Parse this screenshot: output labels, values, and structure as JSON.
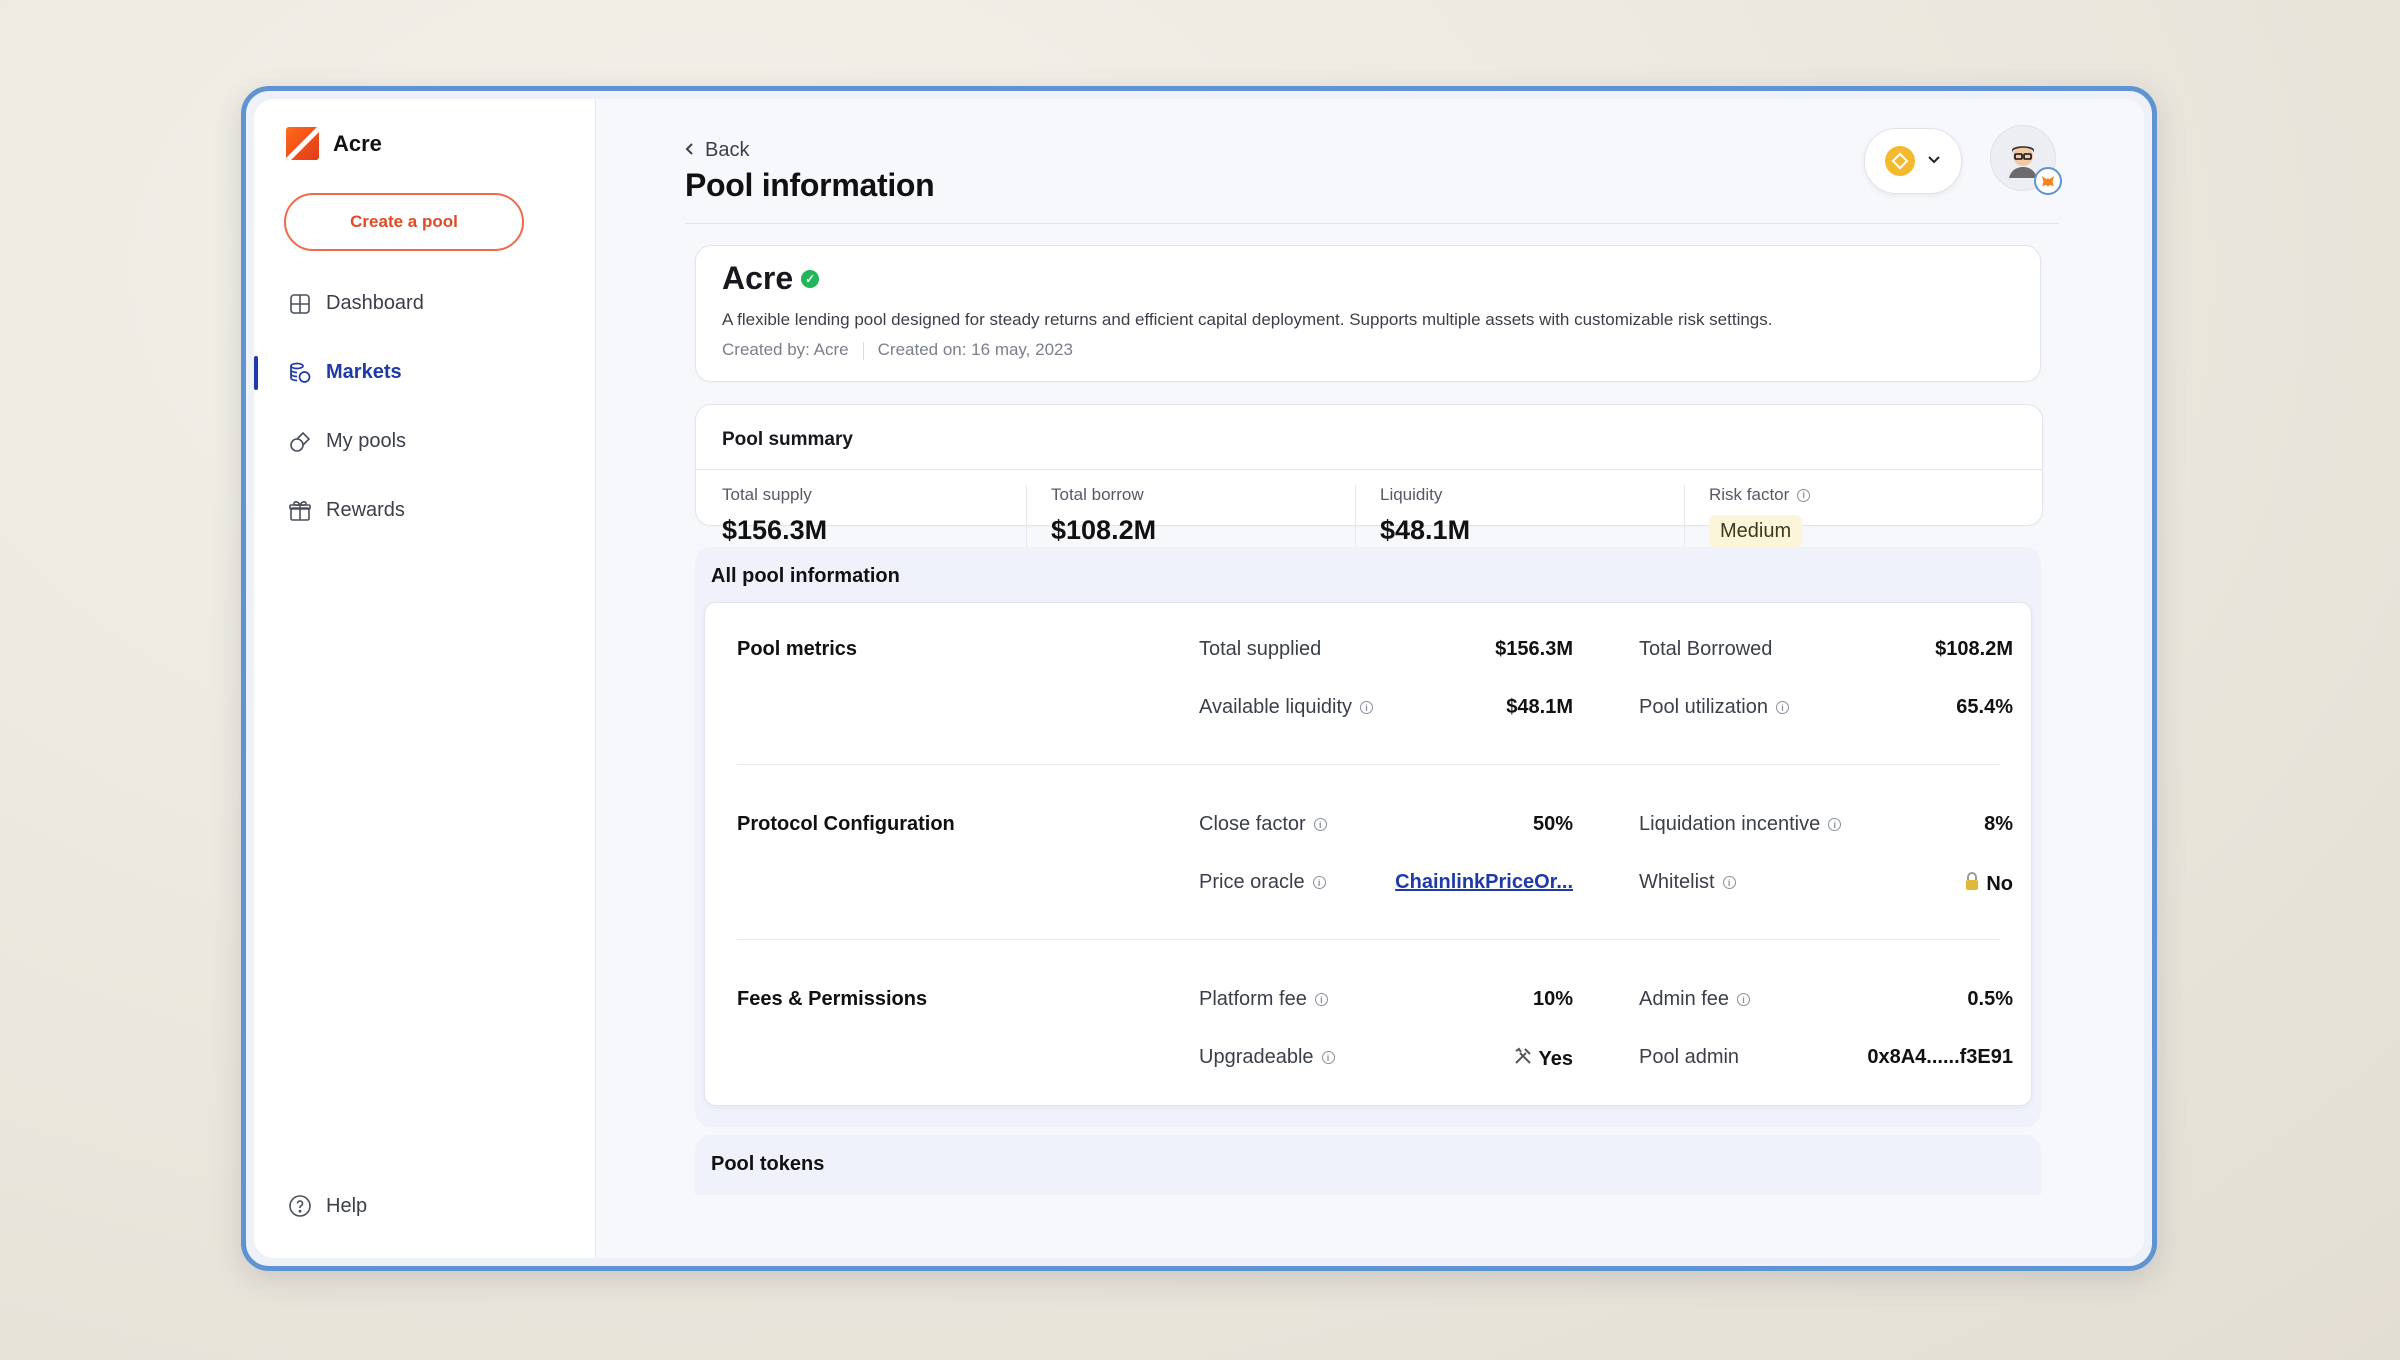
{
  "app": {
    "name": "Acre"
  },
  "sidebar": {
    "create_label": "Create a pool",
    "items": [
      {
        "label": "Dashboard",
        "icon": "grid-icon",
        "active": false
      },
      {
        "label": "Markets",
        "icon": "coins-icon",
        "active": true
      },
      {
        "label": "My pools",
        "icon": "pool-icon",
        "active": false
      },
      {
        "label": "Rewards",
        "icon": "gift-icon",
        "active": false
      }
    ],
    "help_label": "Help"
  },
  "header": {
    "back_label": "Back",
    "title": "Pool information",
    "chain_icon": "bnb-icon"
  },
  "pool": {
    "name": "Acre",
    "description": "A flexible lending pool designed for steady returns and efficient capital deployment. Supports multiple assets with customizable risk settings.",
    "created_by": "Created by: Acre",
    "created_on": "Created on: 16 may, 2023"
  },
  "summary": {
    "title": "Pool summary",
    "total_supply_label": "Total supply",
    "total_supply": "$156.3M",
    "total_borrow_label": "Total borrow",
    "total_borrow": "$108.2M",
    "liquidity_label": "Liquidity",
    "liquidity": "$48.1M",
    "risk_label": "Risk factor",
    "risk": "Medium"
  },
  "all_info": {
    "title": "All pool information",
    "metrics": {
      "title": "Pool metrics",
      "total_supplied_label": "Total supplied",
      "total_supplied": "$156.3M",
      "total_borrowed_label": "Total Borrowed",
      "total_borrowed": "$108.2M",
      "available_liquidity_label": "Available liquidity",
      "available_liquidity": "$48.1M",
      "utilization_label": "Pool utilization",
      "utilization": "65.4%"
    },
    "protocol": {
      "title": "Protocol Configuration",
      "close_factor_label": "Close factor",
      "close_factor": "50%",
      "liq_incentive_label": "Liquidation incentive",
      "liq_incentive": "8%",
      "price_oracle_label": "Price oracle",
      "price_oracle": "ChainlinkPriceOr...",
      "whitelist_label": "Whitelist",
      "whitelist": "No",
      "whitelist_icon": "lock-icon"
    },
    "fees": {
      "title": "Fees & Permissions",
      "platform_fee_label": "Platform fee",
      "platform_fee": "10%",
      "admin_fee_label": "Admin fee",
      "admin_fee": "0.5%",
      "upgradeable_label": "Upgradeable",
      "upgradeable": "Yes",
      "upgradeable_icon": "tools-icon",
      "pool_admin_label": "Pool admin",
      "pool_admin": "0x8A4......f3E91"
    }
  },
  "tokens": {
    "title": "Pool tokens"
  },
  "colors": {
    "accent": "#1e3aa8",
    "brand": "#e04a24",
    "verified": "#21b65a",
    "frame": "#5f93d1"
  }
}
